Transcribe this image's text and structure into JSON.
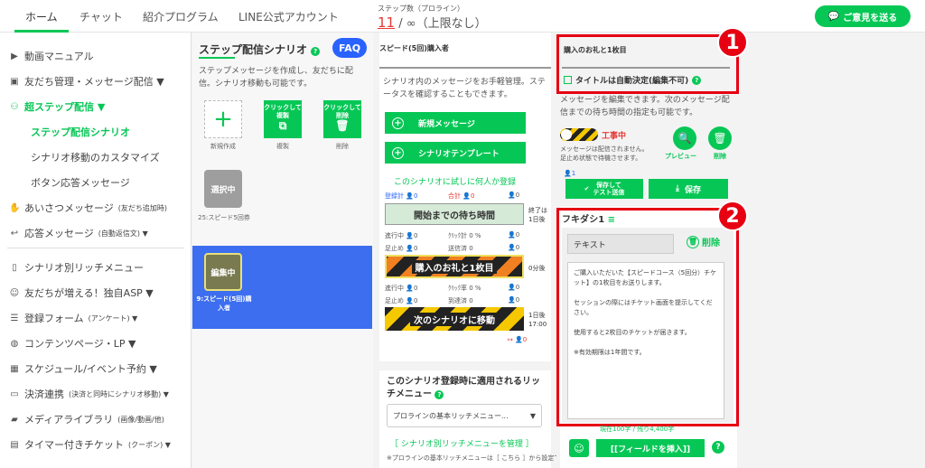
{
  "topnav": {
    "items": [
      "ホーム",
      "チャット",
      "紹介プログラム",
      "LINE公式アカウント"
    ],
    "step_label": "ステップ数（プロライン）",
    "step_current": "11",
    "step_rest": "/ ∞（上限なし）",
    "feedback": "ご意見を送る"
  },
  "sidebar": {
    "items": [
      {
        "icon": "video-icon",
        "label": "動画マニュアル"
      },
      {
        "icon": "contact-icon",
        "label": "友だち管理・メッセージ配信 ▼"
      },
      {
        "icon": "flow-icon",
        "label": "超ステップ配信 ▼"
      },
      {
        "icon": "hand-icon",
        "label": "あいさつメッセージ",
        "small": "(友だち追加時)"
      },
      {
        "icon": "reply-icon",
        "label": "応答メッセージ",
        "small": "(自動返信文) ▼"
      },
      {
        "icon": "phone-icon",
        "label": "シナリオ別リッチメニュー"
      },
      {
        "icon": "users-icon",
        "label": "友だちが増える！独自ASP ▼"
      },
      {
        "icon": "list-icon",
        "label": "登録フォーム",
        "small": "(アンケート) ▼"
      },
      {
        "icon": "globe-icon",
        "label": "コンテンツページ・LP ▼"
      },
      {
        "icon": "calendar-icon",
        "label": "スケジュール/イベント予約 ▼"
      },
      {
        "icon": "card-icon",
        "label": "決済連携",
        "small": "(決済と同時にシナリオ移動) ▼"
      },
      {
        "icon": "folder-icon",
        "label": "メディアライブラリ",
        "small": "(画像/動画/他)"
      },
      {
        "icon": "ticket-icon",
        "label": "タイマー付きチケット",
        "small": "(クーポン) ▼"
      }
    ],
    "sub_items": [
      "ステップ配信シナリオ",
      "シナリオ移動のカスタマイズ",
      "ボタン応答メッセージ"
    ]
  },
  "scenario_list": {
    "title": "ステップ配信シナリオ",
    "faq": "FAQ",
    "description": "ステップメッセージを作成し、友だちに配信。シナリオ移動も可能です。",
    "new_label": "新規作成",
    "copy_btn": "クリックして複製",
    "copy_label": "複製",
    "delete_btn": "クリックして削除",
    "delete_label": "削除",
    "card1_status": "選択中",
    "card1_name": "25:スピード5回券",
    "card2_status": "編集中",
    "card2_name": "9:スピード(5回)購入者"
  },
  "scenario_detail": {
    "name": "スピード(5回)購入者",
    "description": "シナリオ内のメッセージをお手軽管理。ステータスを確認することもできます。",
    "new_message": "新規メッセージ",
    "template": "シナリオテンプレート",
    "trial": "このシナリオに試しに何人か登録",
    "stats_row1": [
      "登録計 👤0",
      "合計 👤0",
      "👤0"
    ],
    "wait_banner": "開始までの待ち時間",
    "stats_row2": [
      "進行中 👤0",
      "ｸﾘｯｸ計 0 %",
      "👤0"
    ],
    "stats_row3": [
      "足止め 👤0",
      "送信済 0",
      "👤0"
    ],
    "msg1": "購入のお礼と1枚目",
    "stats_row4": [
      "進行中 👤0",
      "ｸﾘｯｸ率 0 %",
      "👤0"
    ],
    "stats_row5": [
      "足止め 👤0",
      "到達済 0",
      "👤0"
    ],
    "msg2": "次のシナリオに移動",
    "timing1": "終了は\n1日後",
    "timing2": "0分後",
    "timing3": "1日後\n17:00",
    "rich_title": "このシナリオ登録時に適用されるリッチメニュー",
    "rich_select": "プロラインの基本リッチメニュー...",
    "rich_link": "［ シナリオ別リッチメニューを管理 ］",
    "rich_note": "※プロラインの基本リッチメニューは［ こちら ］から設定できます"
  },
  "message_editor": {
    "title": "購入のお礼と1枚目",
    "auto_title": "タイトルは自動決定(編集不可)",
    "description": "メッセージを編集できます。次のメッセージ配信までの待ち時間の指定も可能です。",
    "wip": "工事中",
    "wip_desc": "メッセージは配信されません。\n足止め状態で待機させます。",
    "preview": "プレビュー",
    "delete": "削除",
    "count": "👤1",
    "save_test": "保存して\nテスト送信",
    "save": "保存",
    "fuki_title": "フキダシ1",
    "fuki_name": "テキスト",
    "fuki_delete": "削除",
    "fuki_text": "ご購入いただいた【スピードコース（5回分）チケット】の1枚目をお送りします。\n\nセッションの際にはチケット画面を提示してください。\n\n使用すると2枚目のチケットが届きます。\n\n※有効期限は1年間です。",
    "char_count": "現在100字 / 残り4,400字",
    "insert": "[[フィールドを挿入]]",
    "badge1": "1",
    "badge2": "2"
  },
  "colors": {
    "accent": "#06c755",
    "highlight": "#e60012",
    "selected": "#3d6ef0"
  }
}
